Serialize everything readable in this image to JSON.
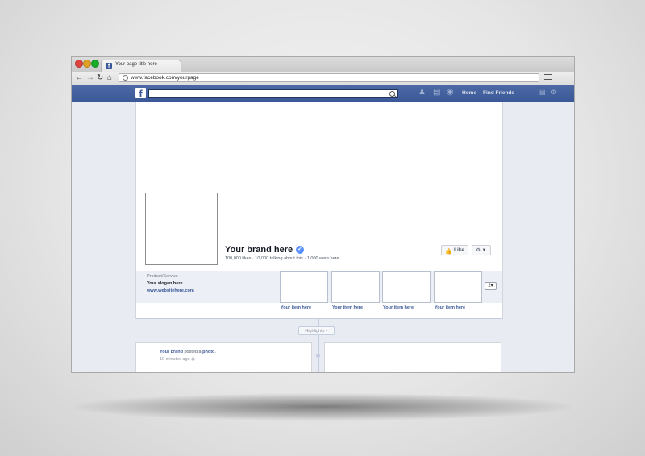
{
  "browser": {
    "tab_title": "Your page title here",
    "url": "www.facebook.com/yourpage"
  },
  "fb_header": {
    "logo": "f",
    "nav_links": [
      "Home",
      "Find Friends"
    ]
  },
  "profile": {
    "brand_name": "Your brand here",
    "stats": "100,000 likes · 10,000 talking about this · 1,000 were here",
    "like_label": "Like"
  },
  "about": {
    "category": "Product/Service",
    "slogan": "Your slogan here.",
    "website": "www.websitehere.com"
  },
  "apps": {
    "items": [
      {
        "label": "Your item here"
      },
      {
        "label": "Your item here"
      },
      {
        "label": "Your item here"
      },
      {
        "label": "Your item here"
      }
    ],
    "more_count": "2"
  },
  "timeline": {
    "highlights_label": "Highlights",
    "post": {
      "author": "Your brand",
      "action": " posted a ",
      "object": "photo",
      "period": ".",
      "time": "10 minutes ago"
    }
  },
  "colors": {
    "fb_blue": "#3b5998",
    "page_bg": "#e9ebf2"
  }
}
